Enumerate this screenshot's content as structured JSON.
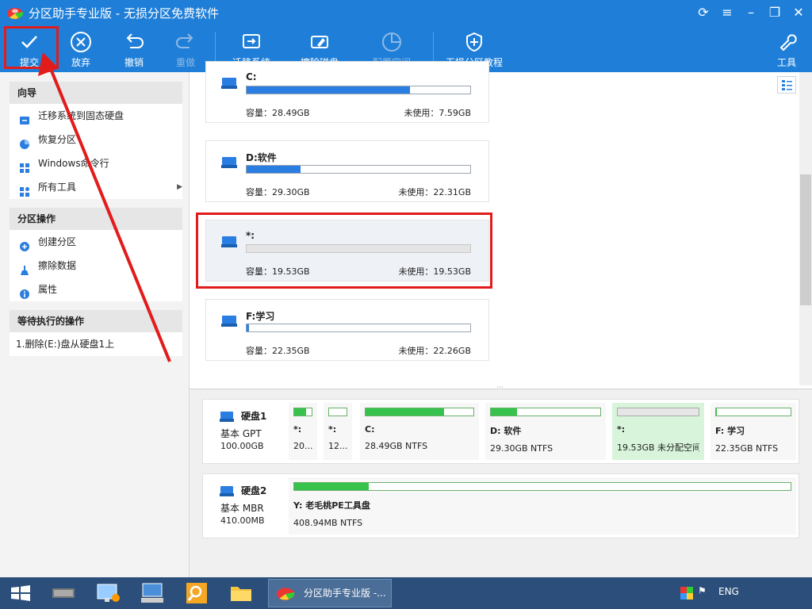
{
  "window": {
    "title": "分区助手专业版 - 无损分区免费软件"
  },
  "toolbar": {
    "submit": "提交",
    "discard": "放弃",
    "undo": "撤销",
    "redo": "重做",
    "migrate_os": "迁移系统",
    "wipe_disk": "擦除磁盘",
    "alloc_space": "配置空间",
    "tutorial": "无损分区教程",
    "tools": "工具"
  },
  "sidebar": {
    "wizard": {
      "title": "向导",
      "items": [
        "迁移系统到固态硬盘",
        "恢复分区",
        "Windows命令行",
        "所有工具"
      ]
    },
    "partition_ops": {
      "title": "分区操作",
      "items": [
        "创建分区",
        "擦除数据",
        "属性"
      ]
    },
    "pending": {
      "title": "等待执行的操作",
      "items": [
        "1.删除(E:)盘从硬盘1上"
      ]
    }
  },
  "partitions": [
    {
      "name": "C:",
      "capacity": "容量：28.49GB",
      "free": "未使用：7.59GB",
      "used_fraction": 0.73
    },
    {
      "name": "D:软件",
      "capacity": "容量：29.30GB",
      "free": "未使用：22.31GB",
      "used_fraction": 0.24
    },
    {
      "name": "*:",
      "capacity": "容量：19.53GB",
      "free": "未使用：19.53GB",
      "used_fraction": 0
    },
    {
      "name": "F:学习",
      "capacity": "容量：22.35GB",
      "free": "未使用：22.26GB",
      "used_fraction": 0.01
    }
  ],
  "disks": [
    {
      "name": "硬盘1",
      "type": "基本 GPT",
      "size": "100.00GB",
      "segments": [
        {
          "name": "*:",
          "desc": "20...",
          "fill": 0.7
        },
        {
          "name": "*:",
          "desc": "12...",
          "fill": 0
        },
        {
          "name": "C:",
          "desc": "28.49GB NTFS",
          "fill": 0.73
        },
        {
          "name": "D: 软件",
          "desc": "29.30GB NTFS",
          "fill": 0.24
        },
        {
          "name": "*:",
          "desc": "19.53GB 未分配空间",
          "fill": 0
        },
        {
          "name": "F: 学习",
          "desc": "22.35GB NTFS",
          "fill": 0.01
        }
      ]
    },
    {
      "name": "硬盘2",
      "type": "基本 MBR",
      "size": "410.00MB",
      "segments": [
        {
          "name": "Y: 老毛桃PE工具盘",
          "desc": "408.94MB NTFS",
          "fill": 0.15
        }
      ]
    }
  ],
  "taskbar": {
    "app_label": "分区助手专业版 -...",
    "lang": "ENG"
  },
  "colors": {
    "accent": "#1f7fd8",
    "usage_bar": "#2a7de1",
    "disk_bar": "#37c24e",
    "highlight": "#e21b1b"
  }
}
